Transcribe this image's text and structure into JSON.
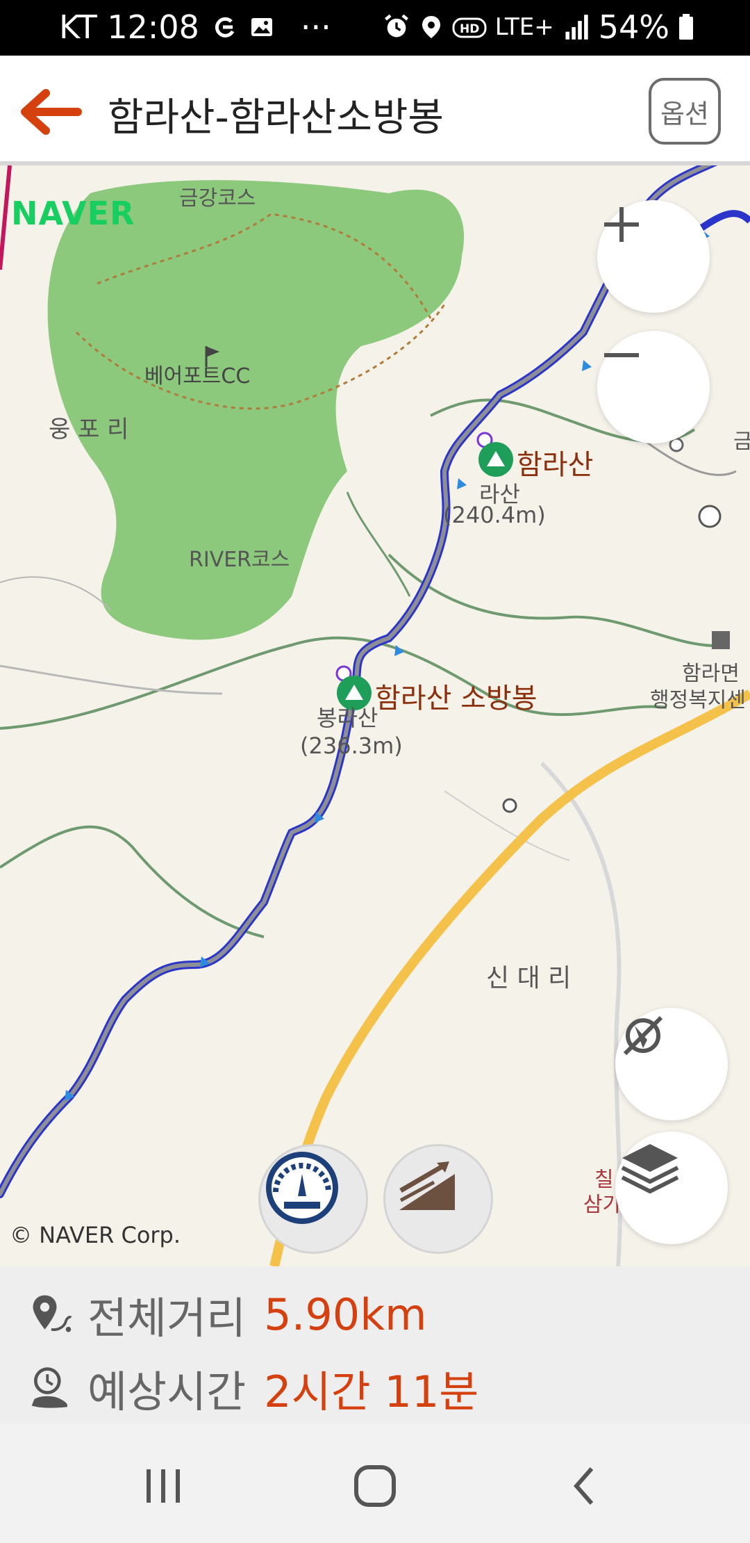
{
  "status_bar": {
    "carrier_time": "KT 12:08",
    "dots": "···",
    "network": "LTE+",
    "battery": "54%"
  },
  "app_bar": {
    "title": "함라산-함라산소방봉",
    "options_label": "옵션"
  },
  "map": {
    "provider_logo": "NAVER",
    "labels": {
      "course_top": "금강코스",
      "golf_club": "베어포트CC",
      "village_left": "웅 포 리",
      "course_river": "RIVER코스",
      "peak1_name_partial": "라산",
      "peak1_height": "(240.4m)",
      "peak2_name_partial": "봉라산",
      "peak2_height": "(236.3m)",
      "village_center": "신 대 리",
      "office_line1": "함라면",
      "office_line2": "행정복지센",
      "edge_right_top": "금",
      "edge_right_bottom1": "칠",
      "edge_right_bottom2": "삼가"
    },
    "peaks": [
      {
        "name": "함라산"
      },
      {
        "name": "함라산 소방봉"
      }
    ],
    "copyright": "© NAVER Corp.",
    "route_color": "#2b35c9",
    "controls": {
      "zoom_in_icon": "plus-icon",
      "zoom_out_icon": "minus-icon",
      "compass_icon": "compass-off-icon",
      "layers_icon": "layers-icon",
      "speedometer_icon": "speedometer-icon",
      "elevation_icon": "elevation-profile-icon"
    }
  },
  "route_info": {
    "distance_label": "전체거리",
    "distance_value": "5.90km",
    "time_label": "예상시간",
    "time_value": "2시간 11분",
    "value_color": "#d5400f"
  },
  "nav_bar": {
    "recent_icon": "recent-apps-icon",
    "home_icon": "home-icon",
    "back_icon": "back-icon"
  }
}
